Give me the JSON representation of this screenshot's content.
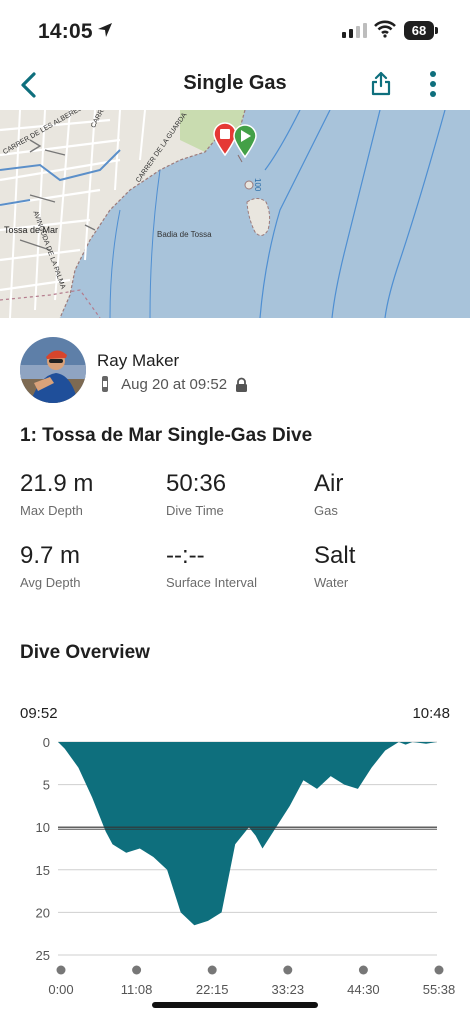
{
  "status_bar": {
    "time": "14:05",
    "battery": "68"
  },
  "nav": {
    "title": "Single Gas",
    "back_icon": "chevron-left-icon",
    "share_icon": "share-icon",
    "more_icon": "more-vertical-icon"
  },
  "map": {
    "labels": [
      "CARRER DE SANT TELM",
      "CARRER DE LA GUARDA",
      "AVINGUDA DE LA PALMA",
      "Tossa de Mar",
      "CARRER DE LES ALBERES",
      "Badia de Tossa",
      "100"
    ],
    "markers": [
      "stop-marker-icon",
      "start-marker-icon"
    ]
  },
  "profile": {
    "name": "Ray Maker",
    "date": "Aug 20 at 09:52",
    "device_icon": "watch-icon",
    "privacy_icon": "lock-icon"
  },
  "activity": {
    "title": "1: Tossa de Mar Single-Gas Dive"
  },
  "stats": [
    {
      "value": "21.9 m",
      "label": "Max Depth"
    },
    {
      "value": "50:36",
      "label": "Dive Time"
    },
    {
      "value": "Air",
      "label": "Gas"
    },
    {
      "value": "9.7 m",
      "label": "Avg Depth"
    },
    {
      "value": "--:--",
      "label": "Surface Interval"
    },
    {
      "value": "Salt",
      "label": "Water"
    }
  ],
  "overview": {
    "title": "Dive Overview",
    "start_time": "09:52",
    "end_time": "10:48"
  },
  "colors": {
    "accent": "#0e6f7d",
    "map_water": "#a8c3da",
    "map_land": "#e9e6df",
    "stop_marker": "#e53935",
    "start_marker": "#43a047"
  },
  "chart_data": {
    "type": "area",
    "y_reversed": true,
    "ylim": [
      0,
      25
    ],
    "y_ticks": [
      "0",
      "5",
      "10",
      "15",
      "20",
      "25"
    ],
    "x_ticks": [
      "0:00",
      "11:08",
      "22:15",
      "33:23",
      "44:30",
      "55:38"
    ],
    "reference_line_depth": 10,
    "x_minutes": [
      0,
      1,
      3,
      5,
      7,
      8,
      9,
      10,
      12,
      14,
      16,
      18,
      20,
      22,
      24,
      26,
      28,
      29,
      30,
      32,
      34,
      36,
      38,
      40,
      42,
      44,
      46,
      48,
      50,
      51,
      52,
      54,
      55.6
    ],
    "depth_m": [
      0,
      0.8,
      3,
      6.5,
      10.5,
      12,
      12.5,
      13,
      12.5,
      13.5,
      15,
      20,
      21.5,
      21,
      20,
      12,
      10,
      11,
      12.5,
      10,
      7.5,
      4.5,
      5.5,
      4,
      5,
      5.5,
      3,
      1,
      0,
      0.3,
      0,
      0.2,
      0
    ]
  }
}
